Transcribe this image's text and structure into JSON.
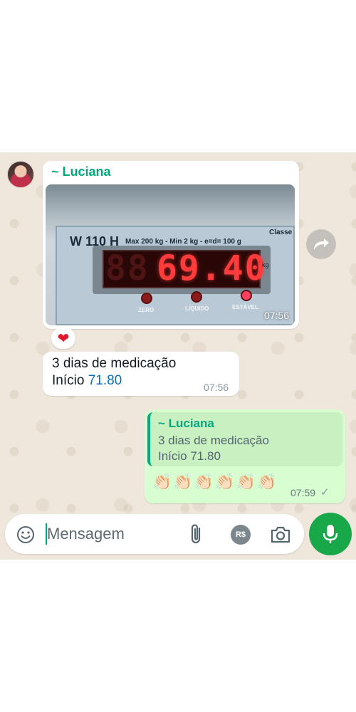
{
  "incoming": {
    "sender_name": "~ Luciana",
    "photo": {
      "scale_model": "W 110 H",
      "scale_spec": "Max  200 kg - Min 2 kg - e=d= 100 g",
      "scale_class": "Classe",
      "display_value": "69.40",
      "display_unit": "kg",
      "leds": [
        "ZERO",
        "LÍQUIDO",
        "ESTÁVEL"
      ],
      "time": "07:56"
    },
    "reaction": "❤",
    "text": {
      "line1": "3 dias de medicação",
      "line2_prefix": "Início ",
      "line2_number": "71.80",
      "time": "07:56"
    }
  },
  "outgoing": {
    "quote": {
      "sender_name": "~ Luciana",
      "line1": "3 dias de medicação",
      "line2": "Início 71.80"
    },
    "emojis": "👏🏻👏🏻👏🏻👏🏻👏🏻👏🏻",
    "time": "07:59",
    "status": "✓"
  },
  "composer": {
    "placeholder": "Mensagem",
    "pay_label": "R$"
  },
  "colors": {
    "accent": "#06a77d",
    "chat_background": "#efe7dc",
    "outgoing_bubble": "#d8fdd0",
    "mic_button": "#18a84a",
    "link_number": "#0b6fb8"
  }
}
